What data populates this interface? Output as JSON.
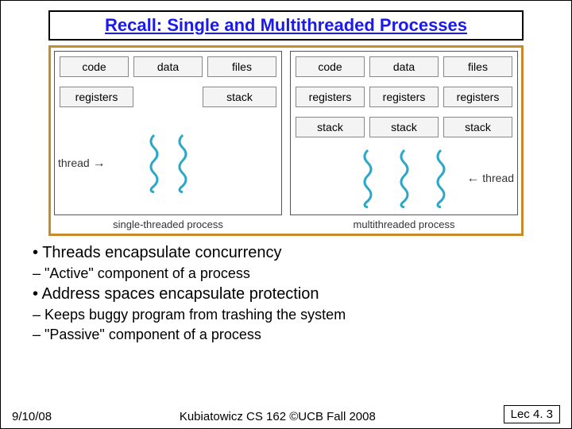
{
  "title": "Recall: Single and Multithreaded Processes",
  "single": {
    "top": [
      "code",
      "data",
      "files"
    ],
    "row2_left": "registers",
    "row2_right": "stack",
    "thread_label": "thread",
    "caption": "single-threaded process"
  },
  "multi": {
    "top": [
      "code",
      "data",
      "files"
    ],
    "row2": [
      "registers",
      "registers",
      "registers"
    ],
    "row3": [
      "stack",
      "stack",
      "stack"
    ],
    "thread_label": "thread",
    "caption": "multithreaded process"
  },
  "bullets": {
    "b1a": "• Threads encapsulate concurrency",
    "b1a_sub": "– \"Active\" component of a process",
    "b1b": "• Address spaces encapsulate protection",
    "b1b_sub1": "– Keeps buggy program from trashing the system",
    "b1b_sub2": "– \"Passive\" component of a process"
  },
  "footer": {
    "date": "9/10/08",
    "center": "Kubiatowicz CS 162 ©UCB Fall 2008",
    "lec": "Lec 4. 3"
  }
}
